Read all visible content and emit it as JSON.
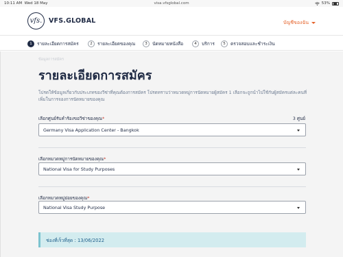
{
  "statusbar": {
    "time": "10:11 AM",
    "date": "Wed 18 May",
    "url": "visa.vfsglobal.com",
    "wifi_icon": "wifi-icon",
    "battery": "53%"
  },
  "header": {
    "logo_mark": "vfs.",
    "logo_text": "VFS.GLOBAL",
    "account_label": "บัญชีของฉัน"
  },
  "steps": [
    {
      "num": "1",
      "label": "รายละเอียดการสมัคร",
      "active": true
    },
    {
      "num": "2",
      "label": "รายละเอียดของคุณ",
      "active": false
    },
    {
      "num": "3",
      "label": "นัดหมายหนังสือ",
      "active": false
    },
    {
      "num": "4",
      "label": "บริการ",
      "active": false
    },
    {
      "num": "5",
      "label": "ตรวจสอบและชำระเงิน",
      "active": false
    }
  ],
  "main": {
    "breadcrumb": "ข้อมูลการสมัคร",
    "title": "รายละเอียดการสมัคร",
    "intro": "โปรดให้ข้อมูลเกี่ยวกับประเภทของวีซ่าที่คุณต้องการสมัคร โปรดทราบว่าหมวดหมู่การนัดหมายผู้สมัคร 1 เลือกจะถูกนำไปใช้กับผู้สมัครแต่ละคนที่เพิ่มในการจองการนัดหมายของคุณ",
    "fields": [
      {
        "label": "เลือกศูนย์รับคำร้องขอวีซ่าของคุณ",
        "value": "Germany Visa Application Center - Bangkok",
        "count": "3 ศูนย์"
      },
      {
        "label": "เลือกหมวดหมู่การนัดหมายของคุณ",
        "value": "National Visa for Study Purposes"
      },
      {
        "label": "เลือกหมวดหมู่ย่อยของคุณ",
        "value": "National Visa Study Purpose"
      }
    ],
    "notice": "ช่องที่เร็วที่สุด : 13/06/2022"
  },
  "colors": {
    "brand_navy": "#1f2a44",
    "accent_orange": "#e5632b",
    "notice_bg": "#d3ecef"
  }
}
